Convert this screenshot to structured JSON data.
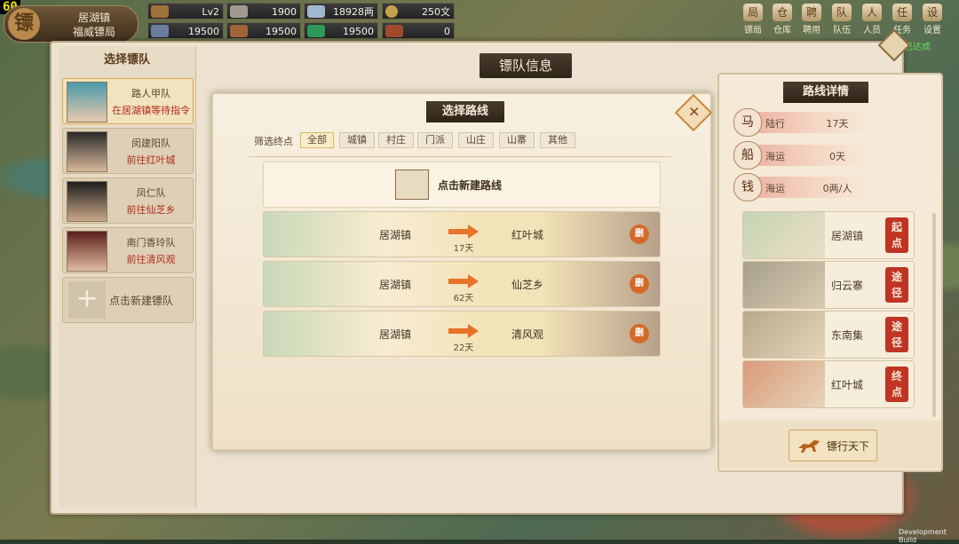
{
  "fps": "60",
  "bureau": {
    "line1": "居湖镇",
    "line2": "福威镖局",
    "emblem": "镖"
  },
  "resources": [
    {
      "value": "Lv2",
      "color": "#a0703a"
    },
    {
      "value": "1900",
      "color": "#a09a8e"
    },
    {
      "value": "18928两",
      "color": "#9fb8d0"
    },
    {
      "value": "250文",
      "color": "#c7a04a"
    },
    {
      "value": "19500",
      "color": "#6a7fa0"
    },
    {
      "value": "19500",
      "color": "#a0643a"
    },
    {
      "value": "19500",
      "color": "#2e9a5a"
    },
    {
      "value": "0",
      "color": "#a04a2a"
    }
  ],
  "menu": [
    "镖局",
    "仓库",
    "聘用",
    "队伍",
    "人员",
    "任务",
    "设置"
  ],
  "menu_icons": [
    "局",
    "仓",
    "聘",
    "队",
    "人",
    "任",
    "设"
  ],
  "done_label": "已达成",
  "info_title": "镖队信息",
  "team_panel": {
    "title": "选择镖队",
    "teams": [
      {
        "name": "路人甲队",
        "status": "在居湖镇等待指令",
        "selected": true
      },
      {
        "name": "闵建阳队",
        "status": "前往红叶城",
        "selected": false
      },
      {
        "name": "凤仁队",
        "status": "前往仙芝乡",
        "selected": false
      },
      {
        "name": "南门香玲队",
        "status": "前往清风观",
        "selected": false
      }
    ],
    "new_team_label": "点击新建镖队"
  },
  "route_dialog": {
    "title": "选择路线",
    "filter_label": "筛选终点",
    "filters": [
      "全部",
      "城镇",
      "村庄",
      "门派",
      "山庄",
      "山寨",
      "其他"
    ],
    "new_route_label": "点击新建路线",
    "routes": [
      {
        "from": "居湖镇",
        "to": "红叶城",
        "days": "17天",
        "delete": "删"
      },
      {
        "from": "居湖镇",
        "to": "仙芝乡",
        "days": "62天",
        "delete": "删"
      },
      {
        "from": "居湖镇",
        "to": "清风观",
        "days": "22天",
        "delete": "删"
      }
    ]
  },
  "route_detail": {
    "title": "路线详情",
    "transport": [
      {
        "label": "陆行",
        "value": "17天",
        "icon": "马"
      },
      {
        "label": "海运",
        "value": "0天",
        "icon": "船"
      },
      {
        "label": "海运",
        "value": "0两/人",
        "icon": "钱"
      }
    ],
    "stops": [
      {
        "name": "居湖镇",
        "tag1": "起",
        "tag2": "点"
      },
      {
        "name": "归云寨",
        "tag1": "途",
        "tag2": "径"
      },
      {
        "name": "东南集",
        "tag1": "途",
        "tag2": "径"
      },
      {
        "name": "红叶城",
        "tag1": "终",
        "tag2": "点"
      }
    ],
    "go_label": "镖行天下"
  },
  "dev_build": "Development Build"
}
